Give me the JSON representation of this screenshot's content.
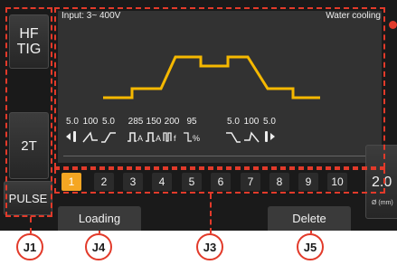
{
  "panel": {
    "input_label": "Input: 3~ 400V",
    "cooling_label": "Water cooling"
  },
  "side_buttons": {
    "hf_tig_line1": "HF",
    "hf_tig_line2": "TIG",
    "trigger_mode": "2T",
    "pulse": "PULSE"
  },
  "params": [
    {
      "value": "5.0",
      "icon": "pre-gas-icon"
    },
    {
      "value": "100",
      "icon": "start-current-icon"
    },
    {
      "value": "5.0",
      "icon": "upslope-icon"
    },
    {
      "value": "285",
      "icon": "peak-current-icon",
      "text": "A"
    },
    {
      "value": "150",
      "icon": "base-current-icon",
      "text": "A"
    },
    {
      "value": "200",
      "icon": "pulse-frequency-icon",
      "text": "f"
    },
    {
      "value": "95",
      "icon": "balance-percent-icon",
      "text": "%"
    },
    {
      "value": "5.0",
      "icon": "downslope-icon"
    },
    {
      "value": "100",
      "icon": "end-current-icon"
    },
    {
      "value": "5.0",
      "icon": "post-gas-icon"
    }
  ],
  "memory_slots": [
    "1",
    "2",
    "3",
    "4",
    "5",
    "6",
    "7",
    "8",
    "9",
    "10"
  ],
  "active_slot": "1",
  "bottom_buttons": {
    "loading": "Loading",
    "delete": "Delete"
  },
  "size_button": {
    "value": "2.0",
    "unit": "Ø (mm)"
  },
  "callouts": {
    "j1": "J1",
    "j4": "J4",
    "j3": "J3",
    "j5": "J5"
  },
  "colors": {
    "curve": "#f5b800",
    "accent": "#f5a623",
    "annotation": "#e23a2a"
  }
}
